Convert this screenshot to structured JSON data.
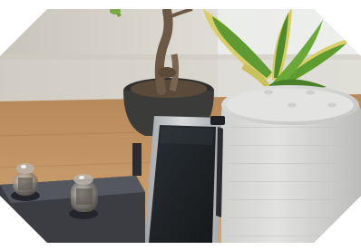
{
  "scene": {
    "subject": "desk-with-tube-amp-music-player-smart-speaker",
    "colors": {
      "wall": "#dcd9d2",
      "window_light": "#eef0ee",
      "desk_wood": "#c79a6a",
      "amp_body": "#3b3d42",
      "player_body": "#c7c9cb",
      "player_screen": "#1f2326",
      "speaker_fabric": "#d8d8d6",
      "pot": "#3a3a38",
      "leaf_green": "#5f9a32",
      "leaf_yellow": "#d8cf6a"
    },
    "objects": [
      {
        "name": "vacuum-tube-amplifier",
        "tubes": 2
      },
      {
        "name": "digital-audio-player"
      },
      {
        "name": "smart-speaker"
      },
      {
        "name": "potted-plants",
        "count": 2
      }
    ]
  }
}
